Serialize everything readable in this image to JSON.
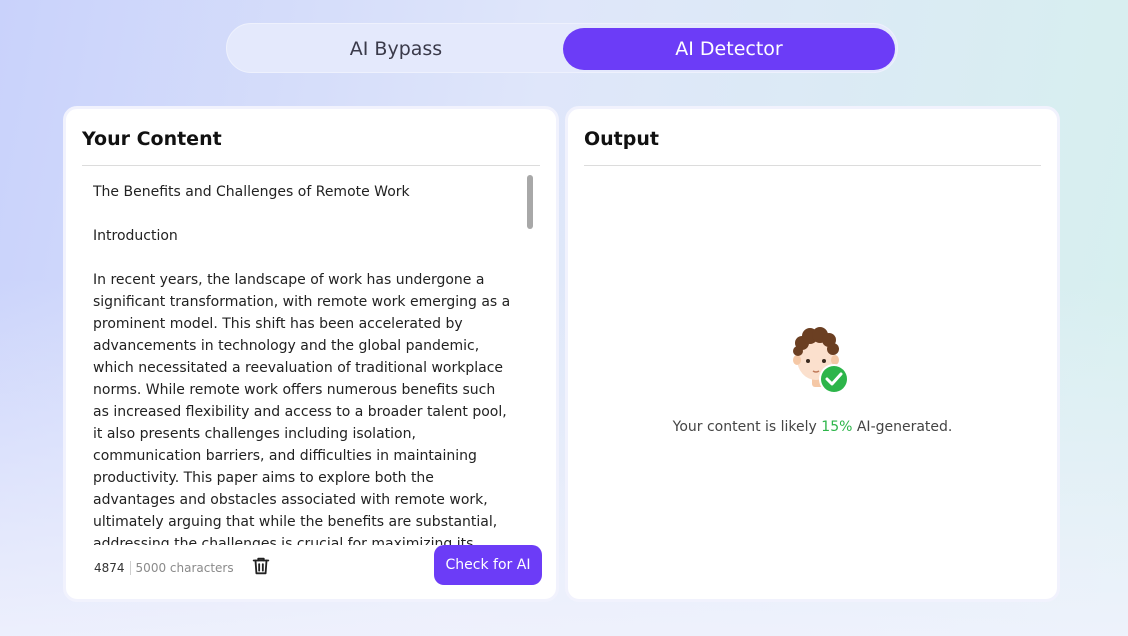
{
  "tabs": [
    {
      "label": "AI Bypass",
      "active": false
    },
    {
      "label": "AI Detector",
      "active": true
    }
  ],
  "input_panel": {
    "title": "Your Content",
    "paragraphs": [
      "The Benefits and Challenges of Remote Work",
      "Introduction",
      "In recent years, the landscape of work has undergone a significant transformation, with remote work emerging as a prominent model. This shift has been accelerated by advancements in technology and the global pandemic, which necessitated a reevaluation of traditional workplace norms. While remote work offers numerous benefits such as increased flexibility and access to a broader talent pool, it also presents challenges including isolation, communication barriers, and difficulties in maintaining productivity. This paper aims to explore both the advantages and obstacles associated with remote work, ultimately arguing that while the benefits are substantial, addressing the challenges is crucial for maximizing its"
    ],
    "char_count": "4874",
    "char_limit": "5000 characters",
    "check_button": "Check for AI",
    "trash_icon": "trash-icon"
  },
  "output_panel": {
    "title": "Output",
    "avatar_icon": "human-face-check-icon",
    "result_prefix": "Your content is likely ",
    "result_percent": "15%",
    "result_suffix": " AI-generated."
  },
  "colors": {
    "accent": "#6c3cf7",
    "success": "#2db54a"
  }
}
